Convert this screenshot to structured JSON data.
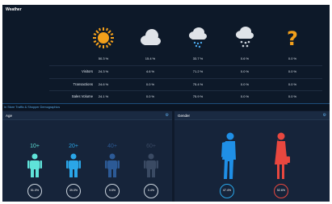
{
  "weather": {
    "title": "Weather",
    "percents": [
      "50.3 %",
      "15.4 %",
      "33.7 %",
      "0.6 %",
      "0.0 %"
    ],
    "icons": [
      "sun-icon",
      "cloud-icon",
      "cloud-rain-icon",
      "cloud-snow-icon",
      "question-icon"
    ],
    "rows": [
      {
        "label": "Visitors",
        "values": [
          "24.3 %",
          "4.6 %",
          "71.2 %",
          "0.0 %",
          "0.0 %"
        ]
      },
      {
        "label": "Transactions",
        "values": [
          "24.6 %",
          "0.0 %",
          "75.4 %",
          "0.0 %",
          "0.0 %"
        ]
      },
      {
        "label": "Sales Volume",
        "values": [
          "24.1 %",
          "0.0 %",
          "75.9 %",
          "0.0 %",
          "0.0 %"
        ]
      }
    ]
  },
  "section": {
    "title": "In Store Traffic & Shopper Demographics"
  },
  "age": {
    "title": "Age",
    "groups": [
      {
        "label": "10+",
        "value": "51.0%",
        "color": "#5fe3d9"
      },
      {
        "label": "20+",
        "value": "39.0%",
        "color": "#2aa6e8"
      },
      {
        "label": "40+",
        "value": "9.5%",
        "color": "#2c5a96"
      },
      {
        "label": "60+",
        "value": "0.4%",
        "color": "#3a4a63"
      }
    ]
  },
  "gender": {
    "title": "Gender",
    "male": {
      "value": "47.4%",
      "color": "#1f8fe6"
    },
    "female": {
      "value": "52.6%",
      "color": "#e8473f"
    }
  }
}
